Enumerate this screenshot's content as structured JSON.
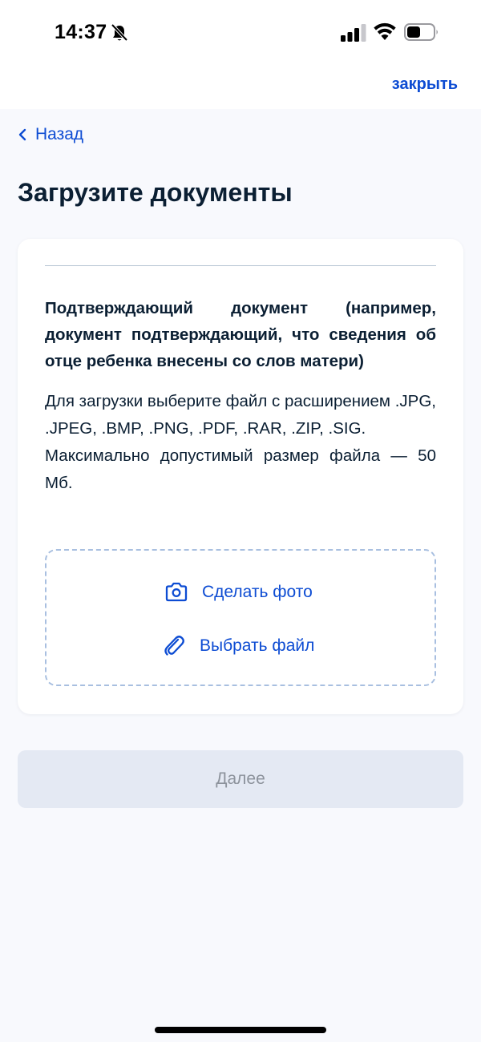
{
  "status_bar": {
    "time": "14:37",
    "icons": [
      "bell-slash-icon",
      "signal-icon",
      "wifi-icon",
      "battery-icon"
    ]
  },
  "header": {
    "close_label": "закрыть"
  },
  "nav": {
    "back_label": "Назад"
  },
  "page": {
    "title": "Загрузите документы"
  },
  "card": {
    "doc_title": "Подтверждающий документ (например, документ подтверждающий, что сведения об отце ребенка внесены со слов матери)",
    "hint_formats": "Для загрузки выберите файл с расширением .JPG, .JPEG, .BMP, .PNG, .PDF, .RAR, .ZIP, .SIG.",
    "hint_size": "Максимально допустимый размер файла — 50 Мб.",
    "upload": {
      "take_photo_label": "Сделать фото",
      "choose_file_label": "Выбрать файл"
    }
  },
  "footer": {
    "next_label": "Далее",
    "next_disabled": true
  },
  "colors": {
    "accent": "#0d4cd3",
    "text": "#0b1f33",
    "background": "#f8f9fd",
    "disabled_bg": "#e4e9f3",
    "disabled_text": "#8d939c",
    "dashed_border": "#a8bfe0"
  }
}
